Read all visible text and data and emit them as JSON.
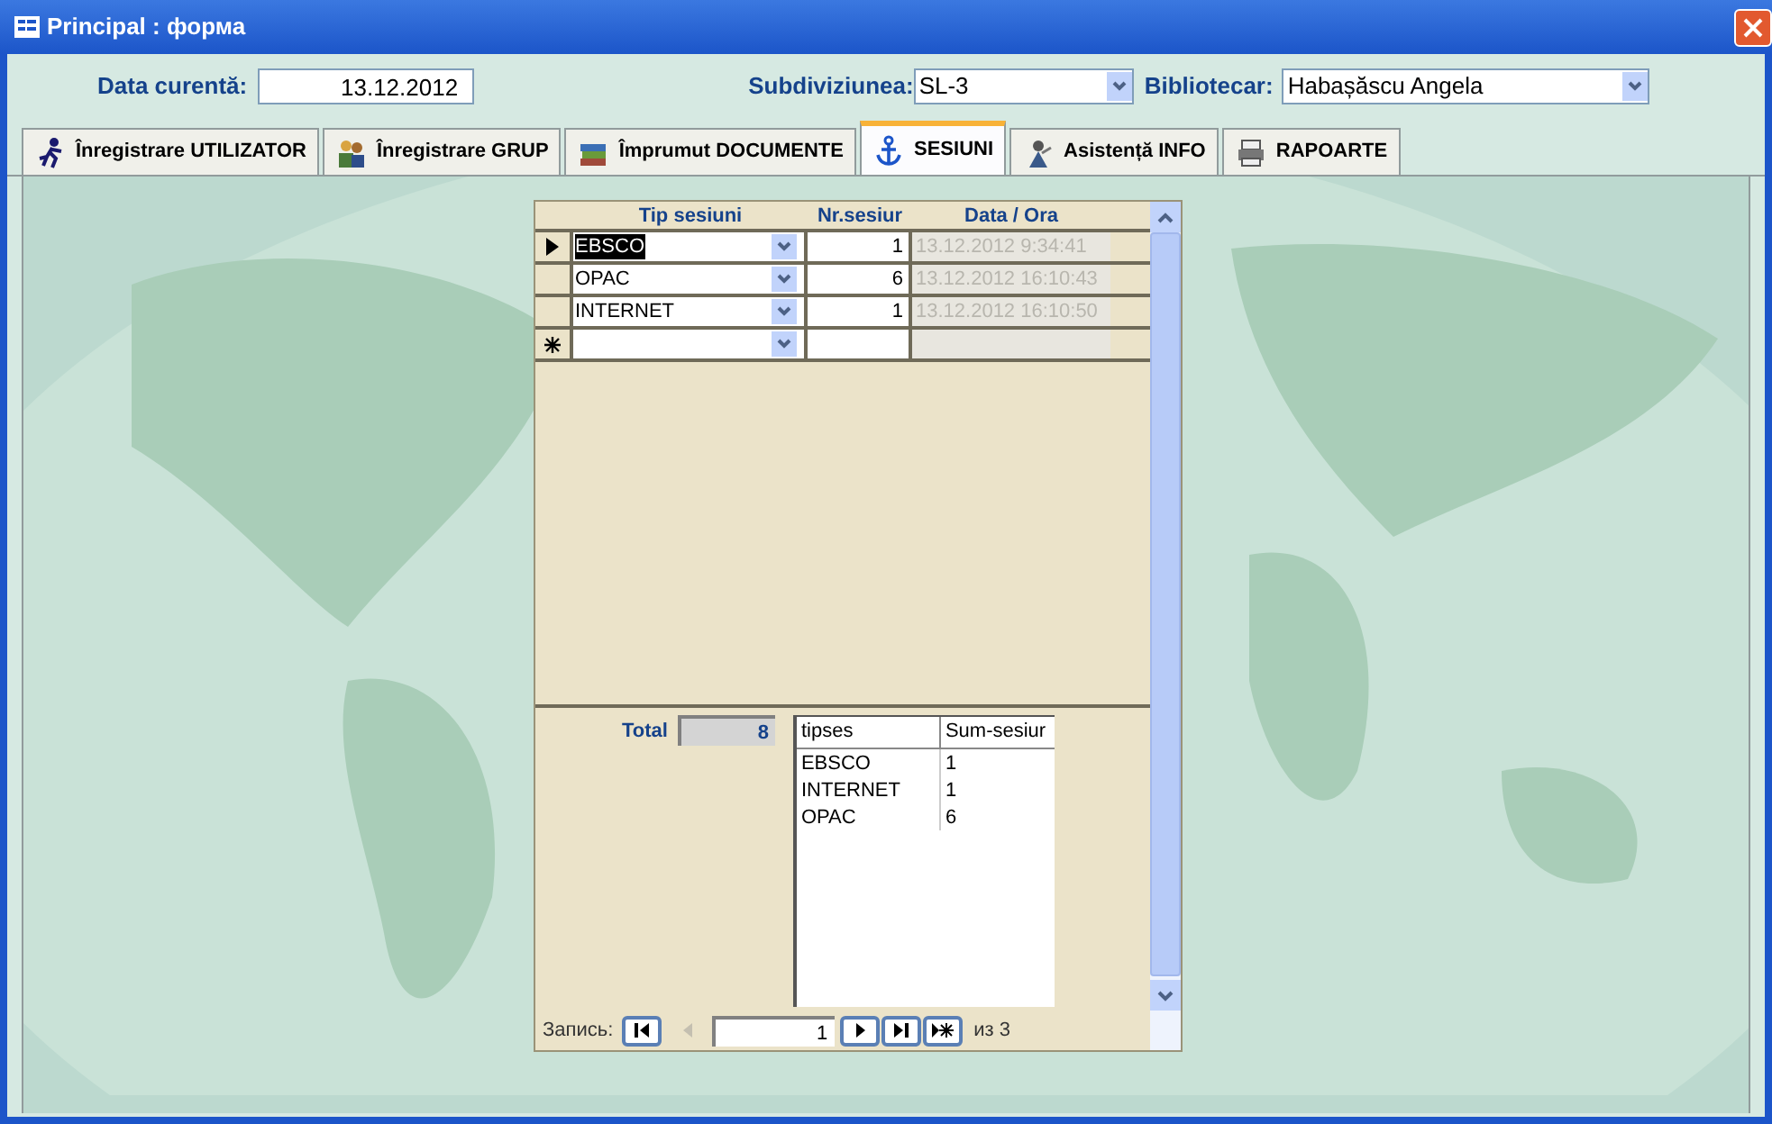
{
  "window": {
    "title": "Principal : форма"
  },
  "header": {
    "date_label": "Data curentă:",
    "date_value": "13.12.2012",
    "subdivision_label": "Subdiviziunea:",
    "subdivision_value": "SL-3",
    "librarian_label": "Bibliotecar:",
    "librarian_value": "Habașăscu Angela"
  },
  "tabs": [
    {
      "label": "Înregistrare UTILIZATOR",
      "kind": "runner",
      "selected": false
    },
    {
      "label": "Înregistrare GRUP",
      "kind": "people",
      "selected": false
    },
    {
      "label": "Împrumut DOCUMENTE",
      "kind": "books",
      "selected": false
    },
    {
      "label": "SESIUNI",
      "kind": "anchor",
      "selected": true
    },
    {
      "label": "Asistență INFO",
      "kind": "helper",
      "selected": false
    },
    {
      "label": "RAPOARTE",
      "kind": "printer",
      "selected": false
    }
  ],
  "sessions": {
    "columns": [
      "Tip sesiuni",
      "Nr.sesiur",
      "Data / Ora"
    ],
    "rows": [
      {
        "type": "EBSCO",
        "count": "1",
        "datetime": "13.12.2012 9:34:41",
        "selected": true
      },
      {
        "type": "OPAC",
        "count": "6",
        "datetime": "13.12.2012 16:10:43",
        "selected": false
      },
      {
        "type": "INTERNET",
        "count": "1",
        "datetime": "13.12.2012 16:10:50",
        "selected": false
      }
    ],
    "total_label": "Total",
    "total_value": "8",
    "summary": {
      "columns": [
        "tipses",
        "Sum-sesiur"
      ],
      "rows": [
        [
          "EBSCO",
          "1"
        ],
        [
          "INTERNET",
          "1"
        ],
        [
          "OPAC",
          "6"
        ]
      ]
    }
  },
  "navigation": {
    "label": "Запись:",
    "current": "1",
    "count": "из 3",
    "buttons": [
      {
        "kind": "first",
        "disabled": false
      },
      {
        "kind": "prev",
        "disabled": true
      },
      {
        "kind": "next",
        "disabled": false
      },
      {
        "kind": "last",
        "disabled": false
      },
      {
        "kind": "new",
        "disabled": false
      }
    ]
  }
}
